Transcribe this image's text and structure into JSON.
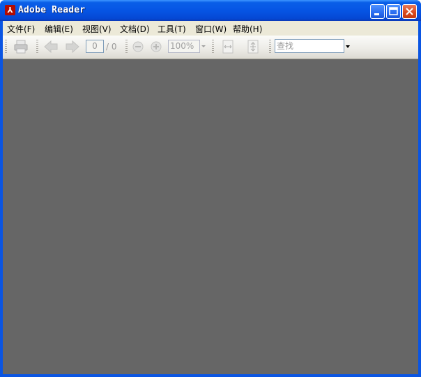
{
  "window": {
    "title": "Adobe Reader",
    "app_icon": "adobe-pdf-icon",
    "controls": [
      "minimize-icon",
      "maximize-icon",
      "close-icon"
    ]
  },
  "menubar": {
    "items": [
      {
        "label": "文件(F)"
      },
      {
        "label": "编辑(E)"
      },
      {
        "label": "视图(V)"
      },
      {
        "label": "文档(D)"
      },
      {
        "label": "工具(T)"
      },
      {
        "label": "窗口(W)"
      },
      {
        "label": "帮助(H)"
      }
    ]
  },
  "toolbar": {
    "icons": [
      "print-icon",
      "back-arrow-icon",
      "forward-arrow-icon",
      "zoom-out-icon",
      "zoom-in-icon",
      "fit-width-icon",
      "fit-page-icon"
    ],
    "page_current": "0",
    "page_total": "/ 0",
    "zoom_value": "100%",
    "search_placeholder": "查找"
  },
  "colors": {
    "title_bar": "#0a55e3",
    "menu_bg": "#ece9d8",
    "document_bg": "#666666"
  }
}
